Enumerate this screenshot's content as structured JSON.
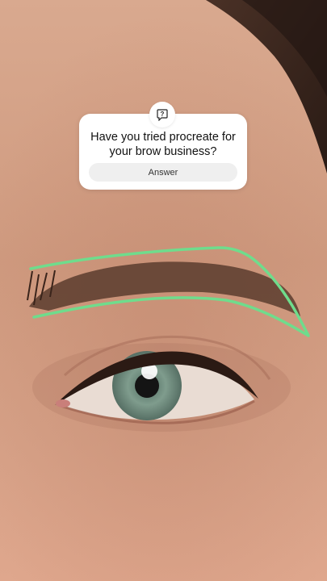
{
  "question_sticker": {
    "icon": "question-speech-bubble-icon",
    "question": "Have you tried procreate for your brow business?",
    "answer_placeholder": "Answer"
  },
  "photo": {
    "subject": "close-up of an eye and eyebrow with a green outline drawn around the brow",
    "outline_color": "#6fdc8c"
  }
}
